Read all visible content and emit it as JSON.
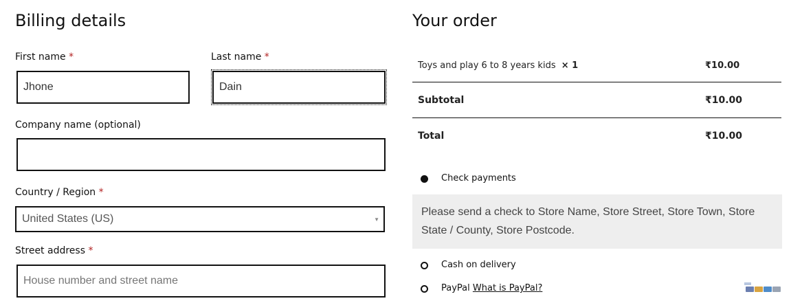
{
  "billing": {
    "heading": "Billing details",
    "first_name": {
      "label": "First name",
      "required": "*",
      "value": "Jhone"
    },
    "last_name": {
      "label": "Last name",
      "required": "*",
      "value": "Dain"
    },
    "company": {
      "label": "Company name (optional)",
      "value": ""
    },
    "country": {
      "label": "Country / Region",
      "required": "*",
      "selected": "United States (US)"
    },
    "street": {
      "label": "Street address",
      "required": "*",
      "value": "",
      "placeholder": "House number and street name"
    }
  },
  "order": {
    "heading": "Your order",
    "item": {
      "name": "Toys and play 6 to 8 years kids",
      "qty": "× 1",
      "price": "₹10.00"
    },
    "subtotal": {
      "label": "Subtotal",
      "value": "₹10.00"
    },
    "total": {
      "label": "Total",
      "value": "₹10.00"
    }
  },
  "payments": {
    "check": {
      "label": "Check payments",
      "selected": true,
      "description": "Please send a check to Store Name, Store Street, Store Town, Store State / County, Store Postcode."
    },
    "cod": {
      "label": "Cash on delivery",
      "selected": false
    },
    "paypal": {
      "label": "PayPal",
      "link": "What is PayPal?",
      "selected": false,
      "logos_icon": "card-logos-icon"
    }
  },
  "colors": {
    "required": "#b22222",
    "payment_box": "#eeeeee",
    "border": "#111111"
  }
}
